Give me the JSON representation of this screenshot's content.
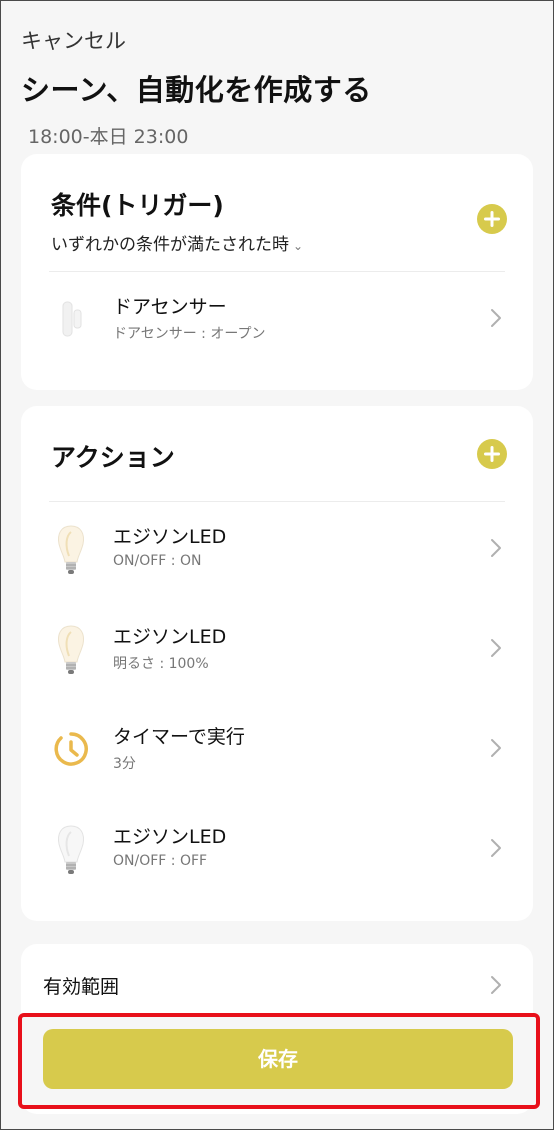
{
  "header": {
    "cancel_label": "キャンセル",
    "title": "シーン、自動化を作成する",
    "schedule": "18:00-本日 23:00"
  },
  "trigger": {
    "heading": "条件(トリガー)",
    "condition_mode": "いずれかの条件が満たされた時",
    "items": [
      {
        "name": "ドアセンサー",
        "detail": "ドアセンサー : オープン",
        "icon": "door-sensor-icon"
      }
    ]
  },
  "actions": {
    "heading": "アクション",
    "items": [
      {
        "name": "エジソンLED",
        "detail": "ON/OFF : ON",
        "icon": "bulb-icon"
      },
      {
        "name": "エジソンLED",
        "detail": "明るさ : 100%",
        "icon": "bulb-icon"
      },
      {
        "name": "タイマーで実行",
        "detail": "3分",
        "icon": "timer-icon"
      },
      {
        "name": "エジソンLED",
        "detail": "ON/OFF : OFF",
        "icon": "bulb-icon"
      }
    ]
  },
  "scope": {
    "label": "有効範囲"
  },
  "footer": {
    "save_label": "保存"
  },
  "colors": {
    "accent": "#d7ca4c",
    "highlight": "#e8101a",
    "background": "#f6f6f6"
  }
}
